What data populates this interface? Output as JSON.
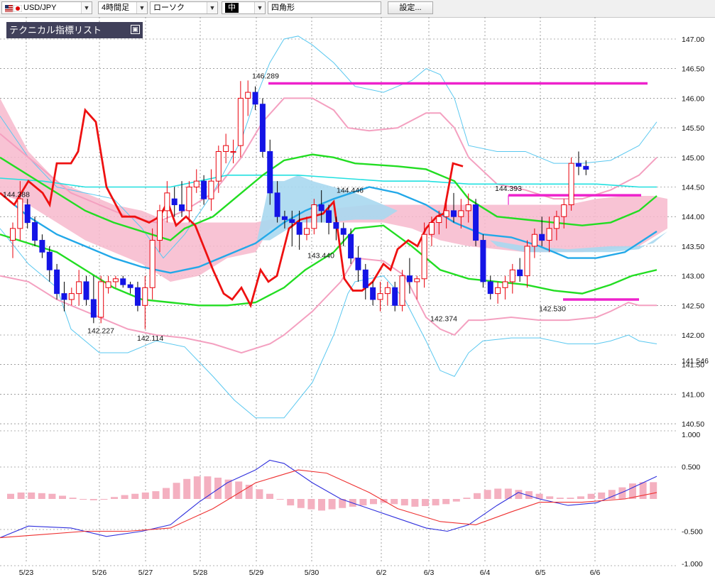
{
  "toolbar": {
    "symbol": "USD/JPY",
    "timeframe": "4時間足",
    "chart_style": "ローソク",
    "line_width": "中",
    "shape_tool": "四角形",
    "settings_label": "設定..."
  },
  "panel": {
    "title": "テクニカル指標リスト",
    "close_glyph": "▣"
  },
  "colors": {
    "up": "#e8000b",
    "down": "#1414e6",
    "cloud": "#f7b8cc",
    "cloud_blue": "#a8d8f0",
    "bb_outer": "#5ac8f0",
    "bb_inner": "#f4a0c0",
    "ma_green": "#22dd22",
    "ma_blue": "#22a8e8",
    "ma_cyan": "#22e0e0",
    "red_line": "#ee1111",
    "magenta": "#ee22cc",
    "macd": "#3030dd",
    "signal": "#ee3030",
    "hist": "#f4b0c0"
  },
  "chart_data": {
    "type": "candlestick",
    "yaxis_ticks": [
      "147.00",
      "146.50",
      "146.00",
      "145.50",
      "145.00",
      "144.50",
      "144.00",
      "143.50",
      "143.00",
      "142.50",
      "142.00",
      "141.50",
      "141.00",
      "140.50"
    ],
    "xaxis_ticks": [
      "5/23",
      "5/26",
      "5/27",
      "5/28",
      "5/29",
      "5/30",
      "6/2",
      "6/3",
      "6/4",
      "6/5",
      "6/6"
    ],
    "current_price_label": "141.546",
    "annotations": [
      "144.388",
      "142.227",
      "142.114",
      "146.289",
      "144.446",
      "143.440",
      "142.374",
      "144.393",
      "142.530"
    ],
    "ohlc": [
      [
        143.6,
        143.9,
        143.3,
        143.8
      ],
      [
        143.8,
        144.6,
        143.6,
        144.3
      ],
      [
        144.2,
        144.3,
        143.8,
        143.9
      ],
      [
        143.9,
        144.0,
        143.5,
        143.6
      ],
      [
        143.6,
        143.7,
        143.3,
        143.4
      ],
      [
        143.4,
        143.5,
        142.9,
        143.1
      ],
      [
        143.1,
        143.2,
        142.6,
        142.7
      ],
      [
        142.7,
        142.9,
        142.4,
        142.6
      ],
      [
        142.6,
        142.8,
        142.5,
        142.7
      ],
      [
        142.7,
        143.1,
        142.5,
        142.9
      ],
      [
        142.9,
        143.0,
        142.5,
        142.6
      ],
      [
        142.6,
        143.0,
        142.2,
        142.3
      ],
      [
        142.3,
        143.0,
        142.2,
        142.9
      ],
      [
        142.8,
        143.0,
        142.7,
        142.9
      ],
      [
        142.9,
        143.0,
        142.8,
        142.95
      ],
      [
        142.95,
        143.0,
        142.8,
        142.85
      ],
      [
        142.85,
        142.9,
        142.7,
        142.8
      ],
      [
        142.8,
        142.9,
        142.4,
        142.5
      ],
      [
        142.5,
        143.0,
        142.1,
        142.8
      ],
      [
        142.8,
        143.8,
        142.6,
        143.6
      ],
      [
        143.6,
        144.2,
        143.4,
        144.1
      ],
      [
        144.1,
        144.6,
        143.9,
        144.4
      ],
      [
        144.3,
        144.5,
        144.0,
        144.2
      ],
      [
        144.2,
        144.6,
        144.0,
        144.1
      ],
      [
        144.1,
        144.6,
        143.9,
        144.5
      ],
      [
        144.5,
        144.8,
        144.4,
        144.6
      ],
      [
        144.6,
        144.7,
        144.2,
        144.3
      ],
      [
        144.3,
        144.8,
        144.1,
        144.6
      ],
      [
        144.6,
        145.2,
        144.4,
        145.1
      ],
      [
        145.1,
        145.4,
        144.9,
        145.2
      ],
      [
        145.1,
        145.3,
        144.9,
        145.1
      ],
      [
        145.2,
        146.29,
        145.0,
        146.0
      ],
      [
        146.0,
        146.3,
        145.7,
        146.1
      ],
      [
        146.1,
        146.2,
        145.8,
        145.9
      ],
      [
        145.9,
        146.0,
        145.0,
        145.1
      ],
      [
        145.1,
        145.3,
        144.2,
        144.4
      ],
      [
        144.4,
        144.6,
        143.9,
        144.0
      ],
      [
        144.0,
        144.1,
        143.8,
        143.95
      ],
      [
        143.95,
        144.1,
        143.5,
        143.9
      ],
      [
        143.9,
        144.1,
        143.44,
        143.7
      ],
      [
        143.7,
        144.0,
        143.6,
        143.8
      ],
      [
        143.8,
        144.3,
        143.7,
        144.2
      ],
      [
        144.2,
        144.446,
        143.9,
        144.1
      ],
      [
        144.1,
        144.2,
        143.7,
        143.9
      ],
      [
        143.9,
        144.0,
        143.6,
        143.8
      ],
      [
        143.8,
        143.9,
        143.5,
        143.7
      ],
      [
        143.7,
        143.8,
        143.2,
        143.3
      ],
      [
        143.3,
        143.5,
        142.9,
        143.1
      ],
      [
        143.1,
        143.2,
        142.6,
        142.8
      ],
      [
        142.8,
        142.9,
        142.5,
        142.6
      ],
      [
        142.6,
        142.9,
        142.4,
        142.7
      ],
      [
        142.7,
        142.9,
        142.5,
        142.8
      ],
      [
        142.8,
        142.9,
        142.4,
        142.5
      ],
      [
        142.5,
        143.1,
        142.4,
        143.0
      ],
      [
        143.0,
        143.3,
        142.7,
        142.9
      ],
      [
        142.9,
        143.0,
        142.6,
        142.95
      ],
      [
        142.95,
        143.9,
        142.8,
        143.7
      ],
      [
        143.7,
        144.0,
        143.5,
        143.9
      ],
      [
        143.9,
        144.1,
        143.7,
        144.0
      ],
      [
        144.0,
        144.3,
        143.8,
        144.1
      ],
      [
        144.1,
        144.4,
        143.9,
        144.0
      ],
      [
        144.0,
        144.3,
        143.8,
        144.1
      ],
      [
        144.1,
        144.39,
        143.9,
        144.2
      ],
      [
        144.2,
        144.3,
        143.5,
        143.6
      ],
      [
        143.6,
        143.7,
        142.8,
        142.9
      ],
      [
        142.9,
        143.0,
        142.6,
        142.7
      ],
      [
        142.7,
        142.9,
        142.53,
        142.8
      ],
      [
        142.8,
        143.0,
        142.6,
        142.9
      ],
      [
        142.9,
        143.2,
        142.7,
        143.1
      ],
      [
        143.1,
        143.3,
        142.9,
        143.0
      ],
      [
        143.0,
        143.6,
        142.8,
        143.5
      ],
      [
        143.5,
        143.8,
        143.3,
        143.7
      ],
      [
        143.7,
        144.0,
        143.5,
        143.6
      ],
      [
        143.6,
        144.0,
        143.4,
        143.8
      ],
      [
        143.8,
        144.1,
        143.6,
        144.0
      ],
      [
        144.0,
        144.3,
        143.8,
        144.2
      ],
      [
        144.2,
        145.0,
        144.1,
        144.9
      ],
      [
        144.9,
        145.1,
        144.7,
        144.85
      ],
      [
        144.85,
        144.95,
        144.7,
        144.8
      ]
    ],
    "macd_ylabels": [
      "1.000",
      "0.500",
      "-0.500",
      "-1.000"
    ]
  }
}
